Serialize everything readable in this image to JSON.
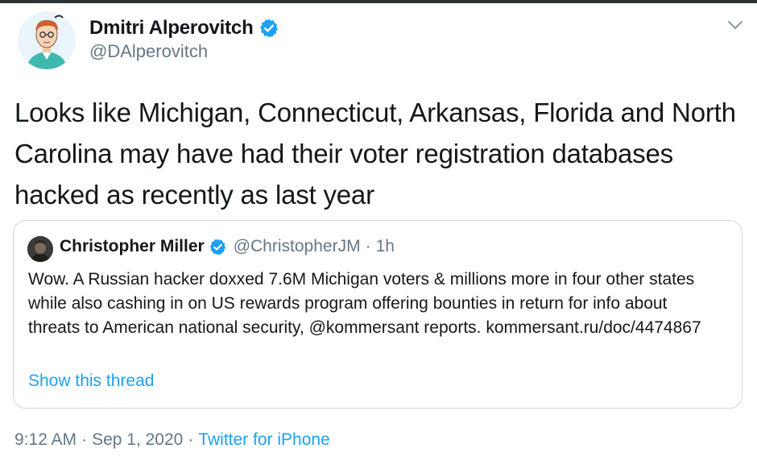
{
  "tweet": {
    "author_name": "Dmitri Alperovitch",
    "author_handle": "@DAlperovitch",
    "text": "Looks like Michigan, Connecticut, Arkansas, Florida and North Carolina may have had their voter registration databases hacked as recently as last year"
  },
  "quoted": {
    "author_name": "Christopher Miller",
    "author_handle": "@ChristopherJM",
    "separator": "·",
    "age": "1h",
    "text": "Wow. A Russian hacker doxxed 7.6M Michigan voters & millions more in four other states while also cashing in on US rewards program offering bounties in return for info about threats to American national security, @kommersant reports. kommersant.ru/doc/4474867",
    "show_thread_label": "Show this thread"
  },
  "footer": {
    "time": "9:12 AM",
    "separator": "·",
    "date": "Sep 1, 2020",
    "source": "Twitter for iPhone"
  },
  "icons": {
    "verified": "verified-badge-icon",
    "caret": "chevron-down-icon"
  },
  "colors": {
    "accent": "#1da1f2",
    "secondary_text": "#657786",
    "border": "#ccd6dd"
  }
}
